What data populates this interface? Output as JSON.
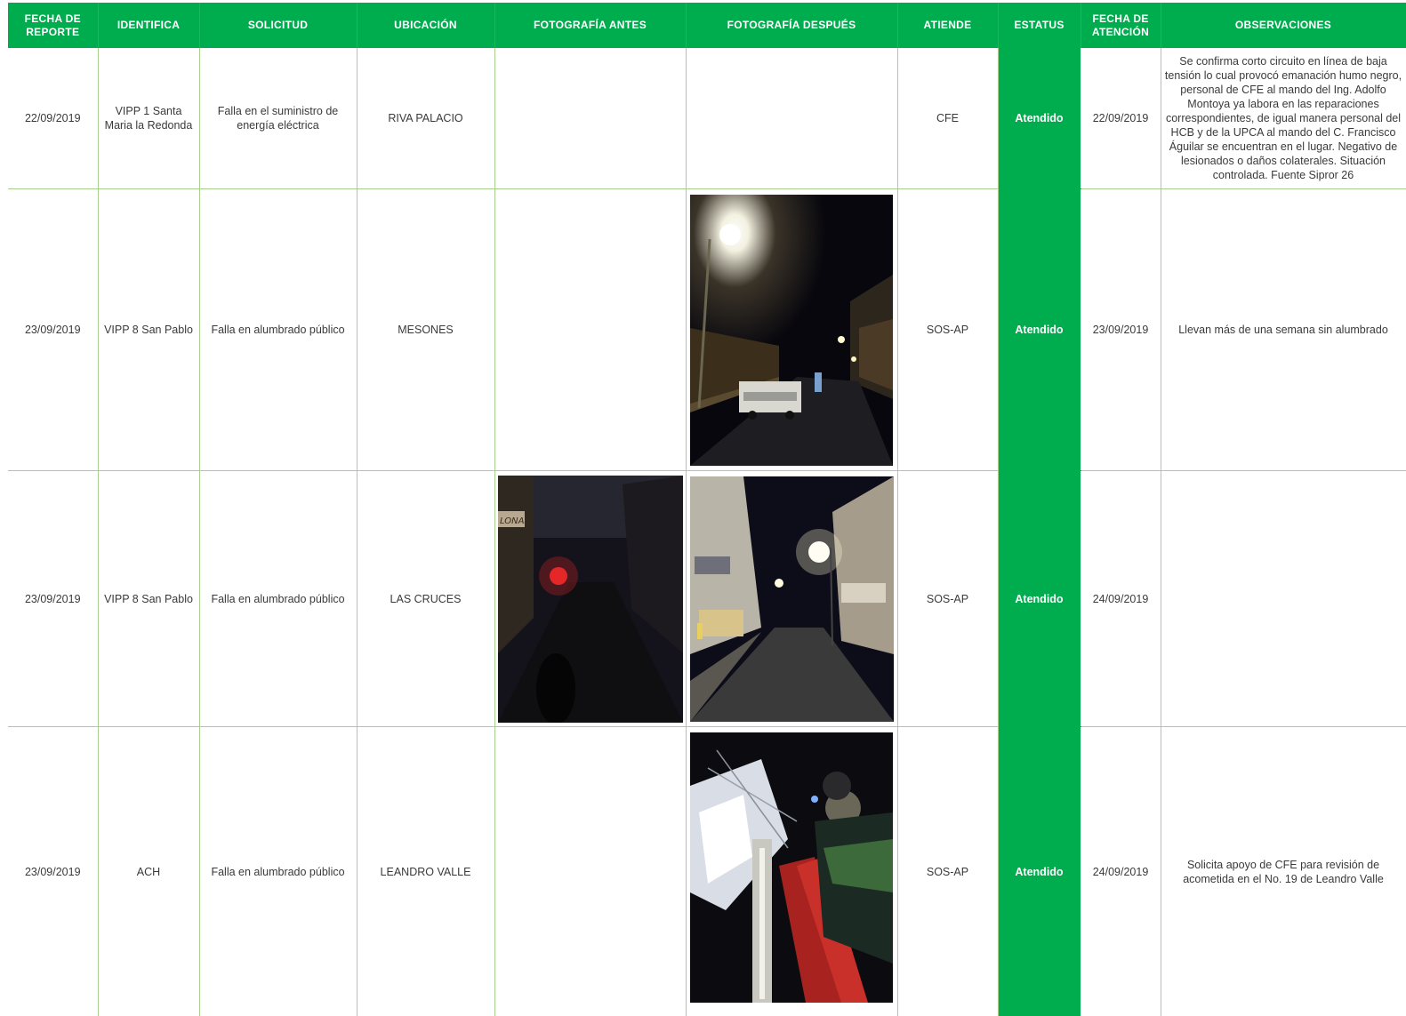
{
  "headers": {
    "fecha_reporte": "FECHA DE REPORTE",
    "identifica": "IDENTIFICA",
    "solicitud": "SOLICITUD",
    "ubicacion": "UBICACIÓN",
    "foto_antes": "FOTOGRAFÍA ANTES",
    "foto_despues": "FOTOGRAFÍA DESPUÉS",
    "atiende": "ATIENDE",
    "estatus": "ESTATUS",
    "fecha_atencion": "FECHA DE ATENCIÓN",
    "observaciones": "OBSERVACIONES"
  },
  "colors": {
    "header_bg": "#00ad4e",
    "status_bg": "#00ad4e",
    "grid_line": "#a8cf8e"
  },
  "rows": [
    {
      "fecha_reporte": "22/09/2019",
      "identifica": "VIPP 1 Santa Maria la Redonda",
      "solicitud": "Falla en el suministro de energía eléctrica",
      "ubicacion": "RIVA PALACIO",
      "foto_antes": "",
      "foto_despues": "",
      "atiende": "CFE",
      "estatus": "Atendido",
      "fecha_atencion": "22/09/2019",
      "observaciones": "Se confirma corto circuito en línea de baja tensión lo cual provocó emanación humo negro, personal de CFE al mando del Ing. Adolfo Montoya ya labora en las reparaciones correspondientes, de igual manera personal del HCB y de la UPCA al mando del C. Francisco Águilar se encuentran en el lugar. Negativo de lesionados o daños colaterales. Situación controlada. Fuente Sipror 26"
    },
    {
      "fecha_reporte": "23/09/2019",
      "identifica": "VIPP 8 San Pablo",
      "solicitud": "Falla en alumbrado público",
      "ubicacion": "MESONES",
      "foto_antes": "",
      "foto_despues": "night-street-lamp-repair-truck-photo",
      "atiende": "SOS-AP",
      "estatus": "Atendido",
      "fecha_atencion": "23/09/2019",
      "observaciones": "Llevan más de una semana sin alumbrado"
    },
    {
      "fecha_reporte": "23/09/2019",
      "identifica": "VIPP 8 San Pablo",
      "solicitud": "Falla en alumbrado público",
      "ubicacion": "LAS CRUCES",
      "foto_antes": "dark-street-before-photo",
      "foto_despues": "lit-street-after-photo",
      "atiende": "SOS-AP",
      "estatus": "Atendido",
      "fecha_atencion": "24/09/2019",
      "observaciones": ""
    },
    {
      "fecha_reporte": "23/09/2019",
      "identifica": "ACH",
      "solicitud": "Falla en alumbrado público",
      "ubicacion": "LEANDRO VALLE",
      "foto_antes": "",
      "foto_despues": "worker-checking-wiring-photo",
      "atiende": "SOS-AP",
      "estatus": "Atendido",
      "fecha_atencion": "24/09/2019",
      "observaciones": "Solicita apoyo de CFE para revisión de acometida en el No. 19 de Leandro Valle"
    }
  ],
  "photo_texts": {
    "lonas_sign": "LONAS"
  }
}
